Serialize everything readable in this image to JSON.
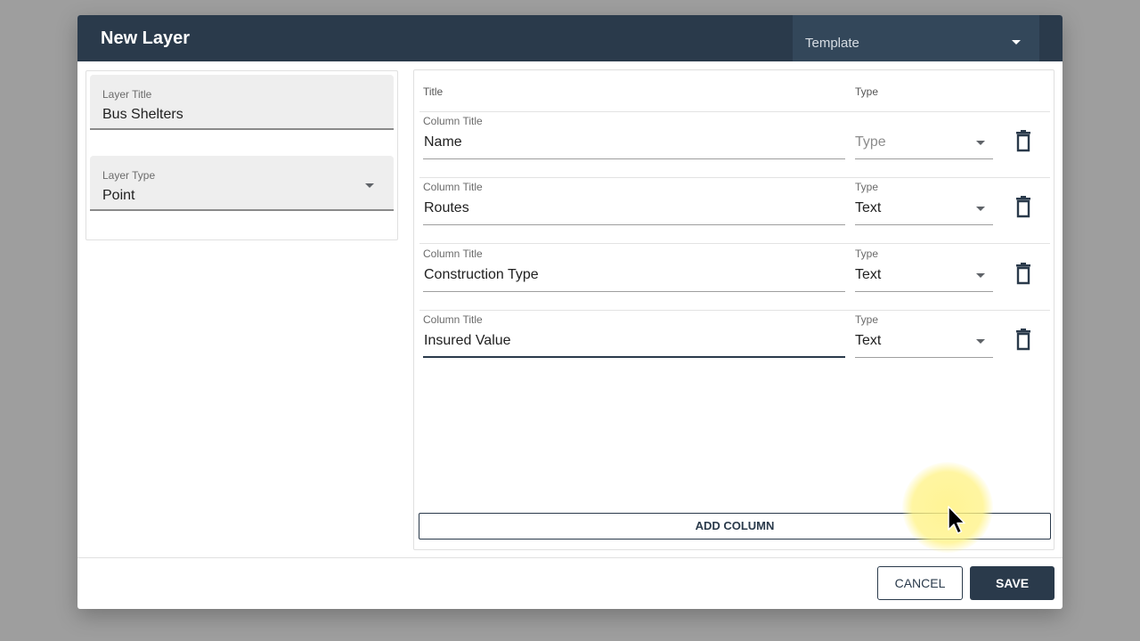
{
  "dialog": {
    "title": "New Layer",
    "template_select": {
      "label": "Template"
    }
  },
  "left_panel": {
    "layer_title": {
      "label": "Layer Title",
      "value": "Bus Shelters"
    },
    "layer_type": {
      "label": "Layer Type",
      "value": "Point"
    }
  },
  "columns_table": {
    "headers": {
      "title": "Title",
      "type": "Type"
    },
    "rows": [
      {
        "title_label": "Column Title",
        "title_value": "Name",
        "type_label": "",
        "type_value": "Type"
      },
      {
        "title_label": "Column Title",
        "title_value": "Routes",
        "type_label": "Type",
        "type_value": "Text"
      },
      {
        "title_label": "Column Title",
        "title_value": "Construction Type",
        "type_label": "Type",
        "type_value": "Text"
      },
      {
        "title_label": "Column Title",
        "title_value": "Insured Value",
        "type_label": "Type",
        "type_value": "Text"
      }
    ],
    "add_column_label": "ADD COLUMN"
  },
  "footer": {
    "cancel_label": "CANCEL",
    "save_label": "SAVE"
  },
  "icons": {
    "trash": "trash-icon",
    "dropdown": "chevron-down-icon",
    "pointer": "mouse-pointer-icon"
  },
  "colors": {
    "header_bg": "#2a3a4b",
    "template_bg": "#33475a",
    "cursor_highlight": "#fff282"
  }
}
